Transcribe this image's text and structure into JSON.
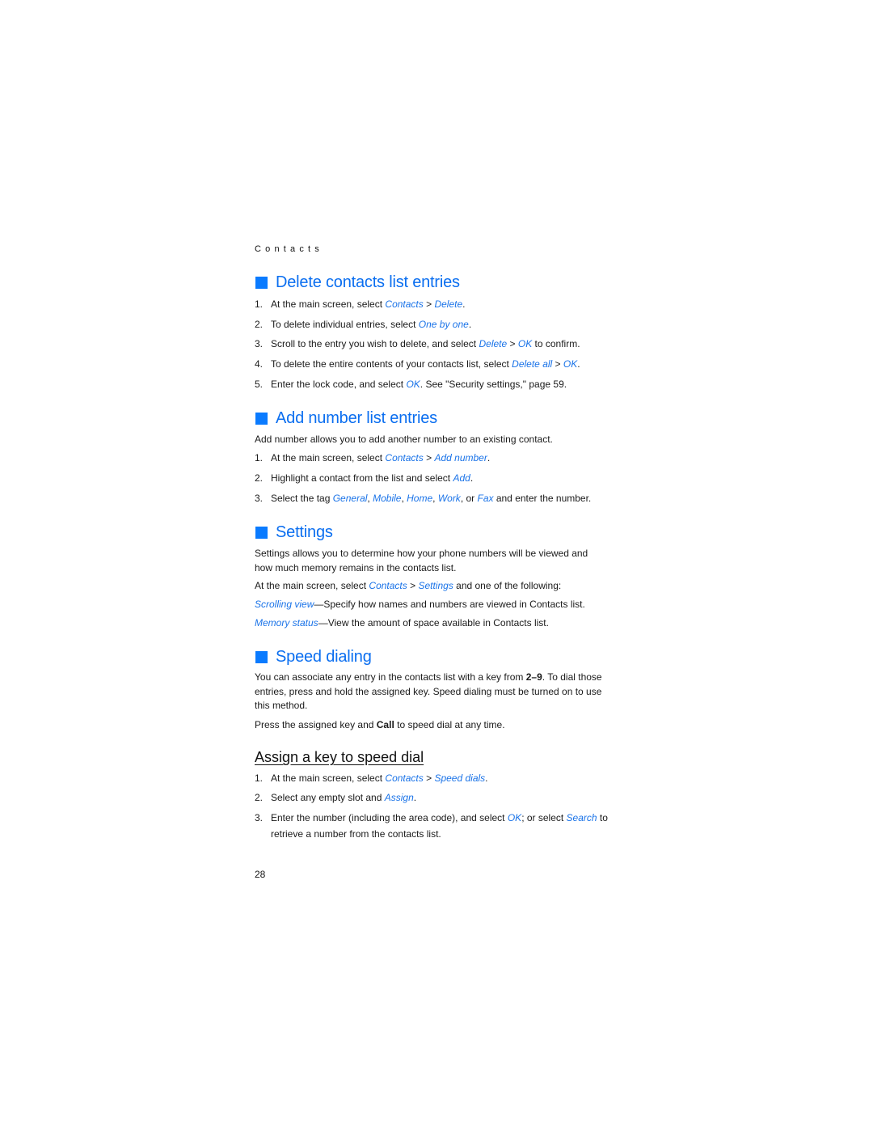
{
  "running_head": "Contacts",
  "page_number": "28",
  "colors": {
    "heading": "#0a6ef0",
    "bullet": "#0a7bff",
    "link": "#1a73e8",
    "text": "#1a1a1a"
  },
  "sections": {
    "delete": {
      "title": "Delete contacts list entries",
      "steps": [
        {
          "num": "1.",
          "pre": "At the main screen, select ",
          "l1": "Contacts",
          "mid": " > ",
          "l2": "Delete",
          "post": "."
        },
        {
          "num": "2.",
          "pre": "To delete individual entries, select ",
          "l1": "One by one",
          "post": "."
        },
        {
          "num": "3.",
          "pre": "Scroll to the entry you wish to delete, and select ",
          "l1": "Delete",
          "mid": " > ",
          "l2": "OK",
          "post": " to confirm."
        },
        {
          "num": "4.",
          "pre": "To delete the entire contents of your contacts list, select ",
          "l1": "Delete all",
          "mid": " > ",
          "l2": "OK",
          "post": "."
        },
        {
          "num": "5.",
          "pre": "Enter the lock code, and select ",
          "l1": "OK",
          "post": ". See \"Security settings,\" page 59."
        }
      ]
    },
    "add_number": {
      "title": "Add number list entries",
      "intro": "Add number allows you to add another number to an existing contact.",
      "steps": [
        {
          "num": "1.",
          "pre": "At the main screen, select ",
          "l1": "Contacts",
          "mid": " > ",
          "l2": "Add number",
          "post": "."
        },
        {
          "num": "2.",
          "pre": "Highlight a contact from the list and select ",
          "l1": "Add",
          "post": "."
        },
        {
          "num": "3.",
          "pre": "Select the tag ",
          "tags": [
            "General",
            "Mobile",
            "Home",
            "Work",
            "Fax"
          ],
          "sep": ", ",
          "or": ", or ",
          "post": " and enter the number."
        }
      ]
    },
    "settings": {
      "title": "Settings",
      "intro": "Settings allows you to determine how your phone numbers will be viewed and how much memory remains in the contacts list.",
      "select": {
        "pre": "At the main screen, select ",
        "l1": "Contacts",
        "mid": " > ",
        "l2": "Settings",
        "post": " and one of the following:"
      },
      "options": [
        {
          "label": "Scrolling view",
          "desc": "—Specify how names and numbers are viewed in Contacts list."
        },
        {
          "label": "Memory status",
          "desc": "—View the amount of space available in Contacts list."
        }
      ]
    },
    "speed": {
      "title": "Speed dialing",
      "intro_pre": "You can associate any entry in the contacts list with a key from ",
      "intro_keys": "2–9",
      "intro_post": ". To dial those entries, press and hold the assigned key. Speed dialing must be turned on to use this method.",
      "press_pre": "Press the assigned key and ",
      "press_key": "Call",
      "press_post": " to speed dial at any time.",
      "sub": {
        "title": "Assign a key to speed dial",
        "steps": [
          {
            "num": "1.",
            "pre": "At the main screen, select ",
            "l1": "Contacts",
            "mid": " > ",
            "l2": "Speed dials",
            "post": "."
          },
          {
            "num": "2.",
            "pre": "Select any empty slot and ",
            "l1": "Assign",
            "post": "."
          },
          {
            "num": "3.",
            "pre": "Enter the number (including the area code), and select ",
            "l1": "OK",
            "mid": "; or select ",
            "l2": "Search",
            "post": " to retrieve a number from the contacts list."
          }
        ]
      }
    }
  }
}
